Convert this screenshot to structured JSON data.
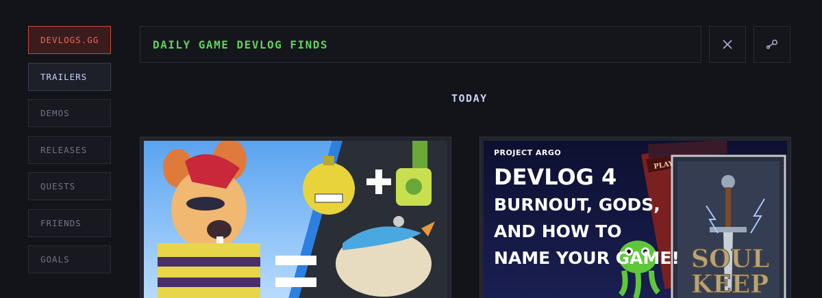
{
  "nav": {
    "brand": "DEVLOGS.GG",
    "items": [
      "TRAILERS",
      "DEMOS",
      "RELEASES",
      "QUESTS",
      "FRIENDS",
      "GOALS"
    ]
  },
  "header": {
    "title": "DAILY GAME DEVLOG FINDS",
    "social": [
      "x-icon",
      "steam-icon"
    ]
  },
  "section": {
    "title": "TODAY"
  },
  "cards": [
    {
      "art": "cartoon-rat-bomb-bird-art"
    },
    {
      "project": "PROJECT ARGO",
      "devlog": "DEVLOG 4",
      "subtitle": [
        "BURNOUT, GODS,",
        "AND HOW TO",
        "NAME YOUR GAME!"
      ],
      "book_text": [
        "SOUL",
        "KEEP"
      ],
      "book_back_text": "PLAYER"
    }
  ],
  "colors": {
    "background": "#131419",
    "brand_red": "#f2675b",
    "headline_green": "#5fd35a",
    "today_blue": "#c6d2f5"
  }
}
